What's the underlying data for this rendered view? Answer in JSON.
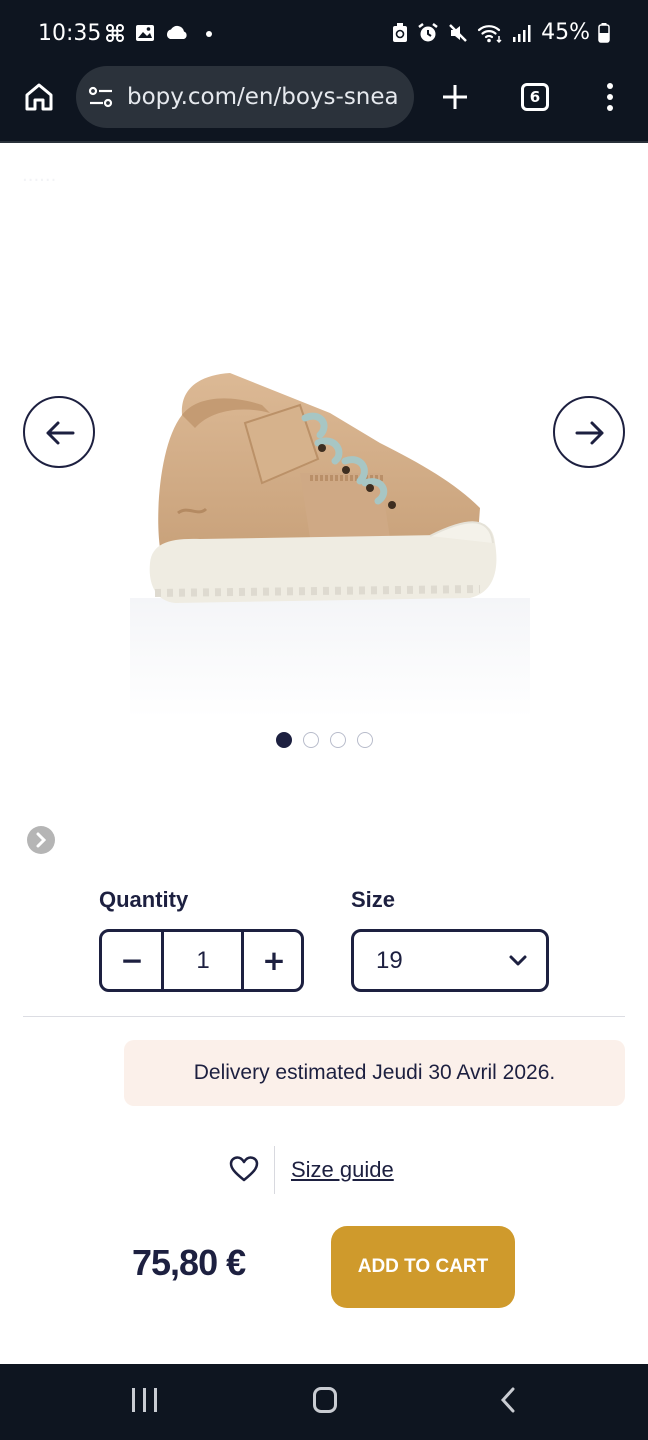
{
  "status_bar": {
    "time": "10:35",
    "battery": "45%",
    "left_icons": [
      "pinwheel-icon",
      "image-icon",
      "cloud-icon",
      "dot-icon"
    ],
    "right_icons": [
      "recycle-icon",
      "alarm-icon",
      "mute-icon",
      "wifi-icon",
      "signal-icon",
      "battery-icon"
    ]
  },
  "browser": {
    "url": "bopy.com/en/boys-snea",
    "tab_count": "6"
  },
  "carousel": {
    "slides": 4,
    "active_index": 0
  },
  "quantity": {
    "label": "Quantity",
    "value": "1",
    "minus": "−",
    "plus": "+"
  },
  "size": {
    "label": "Size",
    "value": "19"
  },
  "delivery": {
    "text": "Delivery estimated Jeudi 30 Avril 2026."
  },
  "links": {
    "size_guide": "Size guide"
  },
  "purchase": {
    "price": "75,80 €",
    "add_to_cart": "ADD TO CART"
  },
  "colors": {
    "navy": "#1d2040",
    "accent": "#cf9a2c",
    "delivery_bg": "#fbf0ea",
    "system_bar": "#0e1520"
  }
}
